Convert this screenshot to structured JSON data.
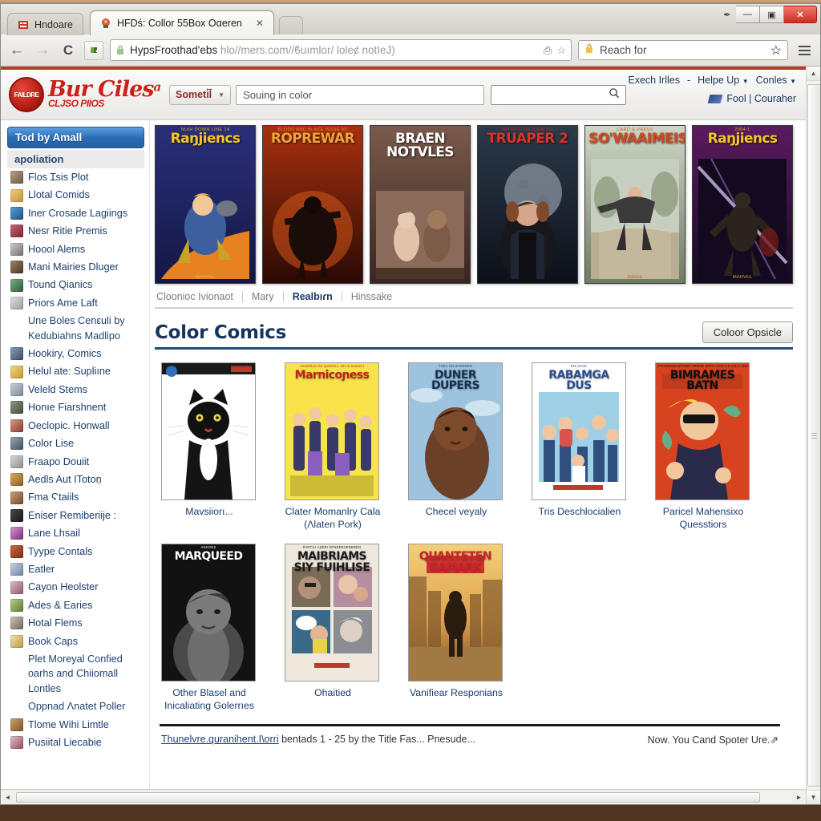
{
  "window": {
    "controls": {
      "minimize": "—",
      "maximize": "▣",
      "close": "✕",
      "extra_dot": "✒"
    }
  },
  "tabs": [
    {
      "label": "Hndoare",
      "icon": "page-icon",
      "active": false
    },
    {
      "label": "HFDś: Collor 55Box Oαeren",
      "icon": "site-favicon",
      "active": true,
      "close": "✕"
    }
  ],
  "browser_toolbar": {
    "back": "←",
    "forward": "→",
    "reload": "C",
    "extension_icon": "puzzle-icon",
    "url_bold": "HypsFroothad'ebs",
    "url_rest": "hlo//mers.com//ϐuımlor/ loleȼ notIeJ)",
    "bookmark_icon": "☆",
    "print_icon": "⎙",
    "search_placeholder": "Reach for",
    "search_star": "☆",
    "menu": "hamburger-icon"
  },
  "site_header": {
    "logo_mark_text": "FAILDRE",
    "logo_title": "Bur Ciles",
    "logo_title_sup": "a",
    "logo_subtitle": "CLJSO PIIOS",
    "category_select": "Someti̇l̄",
    "search_value": "Souing in color",
    "search2_placeholder": "",
    "nav_links": [
      {
        "label": "Exech Irlles",
        "caret": false
      },
      {
        "label": "-",
        "caret": false
      },
      {
        "label": "Helpe Up",
        "caret": true
      },
      {
        "label": "Conles",
        "caret": true
      }
    ],
    "account": "Fool | Couraher",
    "account_icon": "flag-icon"
  },
  "sidebar": {
    "header": "Tod by Amall",
    "subheader": "apoliation",
    "items": [
      {
        "label": "Flos Ɪsis Plot",
        "icon": true,
        "c1": "#b9a38a",
        "c2": "#6a5641"
      },
      {
        "label": "Llotal Comids",
        "icon": true,
        "c1": "#f2cf7f",
        "c2": "#c78f3a"
      },
      {
        "label": "Iner Crosade Lagiings",
        "icon": true,
        "c1": "#5d9fd6",
        "c2": "#1d4f86"
      },
      {
        "label": "Nesr Ritie Premis",
        "icon": true,
        "c1": "#c86a74",
        "c2": "#7e2330"
      },
      {
        "label": "Hoool Alems",
        "icon": true,
        "c1": "#cfcfcf",
        "c2": "#6f6f6f"
      },
      {
        "label": "Mani Mairies Dluger",
        "icon": true,
        "c1": "#9f8568",
        "c2": "#4a3524"
      },
      {
        "label": "Tound Qianics",
        "icon": true,
        "c1": "#7fae84",
        "c2": "#2e5b3a"
      },
      {
        "label": "Priors  Ame Laft",
        "icon": true,
        "c1": "#e4e4e4",
        "c2": "#9a9a9a"
      },
      {
        "label": "Une Boles Cenεuli by Kedubiahns Madlipo",
        "icon": false
      },
      {
        "label": "Hookiry, Comics",
        "icon": true,
        "c1": "#8aa0bd",
        "c2": "#3a4a63"
      },
      {
        "label": "Helul ate: Supliıne",
        "icon": true,
        "c1": "#f3d98a",
        "c2": "#c49428"
      },
      {
        "label": "Veleld Stems",
        "icon": true,
        "c1": "#c8d2de",
        "c2": "#7b8794"
      },
      {
        "label": "Honıe Fiarshnent",
        "icon": true,
        "c1": "#8f9a86",
        "c2": "#3f4a39"
      },
      {
        "label": "Oeclopic. Honwall",
        "icon": true,
        "c1": "#d99a8a",
        "c2": "#8a3a2c"
      },
      {
        "label": "Color Lise",
        "icon": true,
        "c1": "#9aa6b4",
        "c2": "#40505f"
      },
      {
        "label": "Fraapo Douiit",
        "icon": true,
        "c1": "#d8d8d8",
        "c2": "#8e8e8e"
      },
      {
        "label": "Aedls Aut ITotoņ",
        "icon": true,
        "c1": "#d9b06a",
        "c2": "#8a5b1d"
      },
      {
        "label": "Fma Ϛtaiils",
        "icon": true,
        "c1": "#c9a07a",
        "c2": "#7a4a22"
      },
      {
        "label": "Eniser Remiberiije :",
        "icon": true,
        "c1": "#4a4a4a",
        "c2": "#161616"
      },
      {
        "label": "Lane Lhsail",
        "icon": true,
        "c1": "#d79ad6",
        "c2": "#7a2e78"
      },
      {
        "label": "Tyype Contals",
        "icon": true,
        "c1": "#d1693f",
        "c2": "#7d2a12"
      },
      {
        "label": "Eatler",
        "icon": true,
        "c1": "#c6d6e6",
        "c2": "#6d8299"
      },
      {
        "label": "Cayon Heolster",
        "icon": true,
        "c1": "#e2b9c6",
        "c2": "#8a5a6a"
      },
      {
        "label": "Ades & Earies",
        "icon": true,
        "c1": "#b6cf8e",
        "c2": "#5d7a33"
      },
      {
        "label": "Hotal Flems",
        "icon": true,
        "c1": "#cfc6b6",
        "c2": "#6f665a"
      },
      {
        "label": "Book Caps",
        "icon": true,
        "c1": "#f0e2b0",
        "c2": "#b99a3e"
      },
      {
        "label": "Plet Moreyal Confied oarhs and Chiiomall Lontles",
        "icon": false
      },
      {
        "label": "Oppnad Ʌnatet Poller",
        "icon": false
      },
      {
        "label": "Tlome Wihi Limtle",
        "icon": true,
        "c1": "#c9a472",
        "c2": "#7b5324"
      },
      {
        "label": "Pusiital Liecabie",
        "icon": true,
        "c1": "#e0c3cb",
        "c2": "#97495e"
      }
    ]
  },
  "carousel": [
    {
      "title": "Raŋjiencs",
      "title_color": "#f6c623",
      "bg1": "#2b2f7a",
      "bg2": "#141744",
      "sub": "NUIH DOWN LINE 14",
      "bottom": "MARVEL",
      "figure": "hero-orange-blast"
    },
    {
      "title": "ROPREWAR",
      "title_color": "#f0a33c",
      "bg1": "#a8300f",
      "bg2": "#2a0a04",
      "sub": "BLOOD AND BLAZE ISSUE N2",
      "bottom": "",
      "figure": "flame-hero"
    },
    {
      "title": "BRAEN NOTVLES",
      "title_color": "#ffffff",
      "bg1": "#7a5a4c",
      "bg2": "#3a2620",
      "sub": "",
      "bottom": "",
      "figure": "sepia-scene"
    },
    {
      "title": "TRUAPER 2",
      "title_color": "#d8342c",
      "bg1": "#2c3a4a",
      "bg2": "#0c1018",
      "sub": "AN EPIC RETURN TO",
      "bottom": "",
      "figure": "moon-man"
    },
    {
      "title": "SO'WAAIMEIS",
      "title_color": "#d24a1e",
      "bg1": "#cfd6c8",
      "bg2": "#6e7c63",
      "sub": "CARD & PRESS",
      "bottom": "IMAGE",
      "figure": "jumping-ninja"
    },
    {
      "title": "Raŋjiencs",
      "title_color": "#f6c623",
      "bg1": "#5b1b60",
      "bg2": "#140a20",
      "sub": "2004-1",
      "bottom": "MARVEL",
      "figure": "dark-hero"
    }
  ],
  "subnav": {
    "items": [
      {
        "label": "Cloonioc Ivionaot",
        "current": false
      },
      {
        "label": "Mary",
        "current": false
      },
      {
        "label": "Realbıɾn",
        "current": true
      },
      {
        "label": "Hinssake",
        "current": false
      }
    ]
  },
  "section": {
    "title": "Color Comics",
    "action_button": "Coloor Opsicle"
  },
  "grid": [
    {
      "caption": "Mavsiiorı...",
      "cover_title": "",
      "title_color": "#1a1a1a",
      "bg1": "#ffffff",
      "bg2": "#f2f2f2",
      "art": "black-cat",
      "top_strip": "THE BLACK CAT2 NUMBER 1  — A MYSTERIOUS JOKE"
    },
    {
      "caption": "Clater Momanlry Cala (Ʌlaten Pork)",
      "cover_title": "Marnicoɲess",
      "title_color": "#c02020",
      "bg1": "#f6e44a",
      "bg2": "#e9d43c",
      "art": "crowd-yellow",
      "top_strip": "ASODRLE KE QIURALL OFI E emaaoʼt"
    },
    {
      "caption": "Checel veyaly",
      "cover_title": "DUNER DUPERS",
      "title_color": "#17314f",
      "bg1": "#aecbe2",
      "bg2": "#7ea9cc",
      "art": "portrait-sky",
      "top_strip": "THEA OU ZAVENKO"
    },
    {
      "caption": "Tris Deschlocialien",
      "cover_title": "RABAMGA DUS",
      "title_color": "#2b4e8f",
      "bg1": "#ffffff",
      "bg2": "#cfe0ee",
      "art": "family-group",
      "top_strip": "EDI EIOE"
    },
    {
      "caption": "Paricel Mahensixo Quesstiors",
      "cover_title": "BIMRAMES BATN",
      "title_color": "#101010",
      "bg1": "#d8431f",
      "bg2": "#b4330f",
      "art": "sunglasses-man",
      "top_strip": "PHAMKOE-OTHWE PEORE WITH LOW A E CE C WELLIUARRRERE"
    },
    {
      "caption": "Other Blasel and Inicaliating Golerrıes",
      "cover_title": "MARQUEED",
      "title_color": "#ffffff",
      "bg1": "#171717",
      "bg2": "#050505",
      "art": "bw-portrait",
      "top_strip": "ANSONS"
    },
    {
      "caption": "Ohaitied",
      "cover_title": "MAIΒRIAMS SIY FUIHLISE",
      "title_color": "#1b1b1b",
      "bg1": "#efe9dd",
      "bg2": "#ddd4c4",
      "art": "four-panel",
      "top_strip": "PARTILI AZERI SPNEDEVEDEBEN"
    },
    {
      "caption": "Vanifiear Responians",
      "cover_title": "QUANTETEN GAMARK",
      "title_color": "#c8242a",
      "bg1": "#f0c46a",
      "bg2": "#8a6b3a",
      "art": "walking-silhouette",
      "top_strip": ""
    }
  ],
  "site_footer": {
    "link": "Thunelvre.quranihent.Ι\\orri",
    "text": "bentads 1 - 25 by the Title Fas... Pnesude...",
    "right": "Now. You Cand Spoter Ure.⇗"
  },
  "scrollbars": {
    "v_up": "▲",
    "v_down": "▼",
    "h_left": "◄",
    "h_right": "►"
  }
}
